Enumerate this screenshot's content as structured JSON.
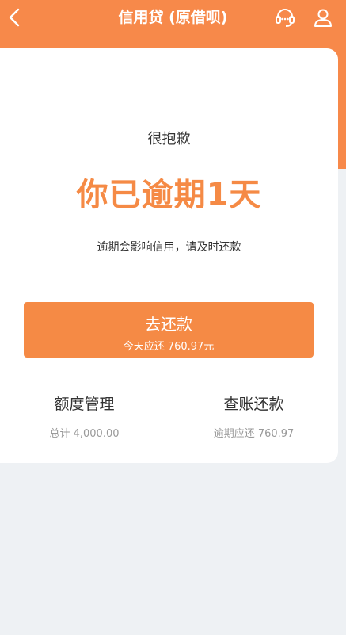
{
  "colors": {
    "accent": "#f58a45",
    "header_bg": "#f7894a",
    "page_bg": "#eef1f4"
  },
  "header": {
    "title": "信用贷 (原借呗)",
    "back_icon": "chevron-left-icon",
    "service_icon": "customer-service-icon",
    "user_icon": "user-icon"
  },
  "card": {
    "apology": "很抱歉",
    "headline": "你已逾期1天",
    "warning": "逾期会影响信用，请及时还款",
    "repay_button": {
      "label": "去还款",
      "sub": "今天应还 760.97元"
    },
    "features": [
      {
        "title": "额度管理",
        "sub": "总计 4,000.00"
      },
      {
        "title": "查账还款",
        "sub": "逾期应还 760.97"
      }
    ]
  }
}
